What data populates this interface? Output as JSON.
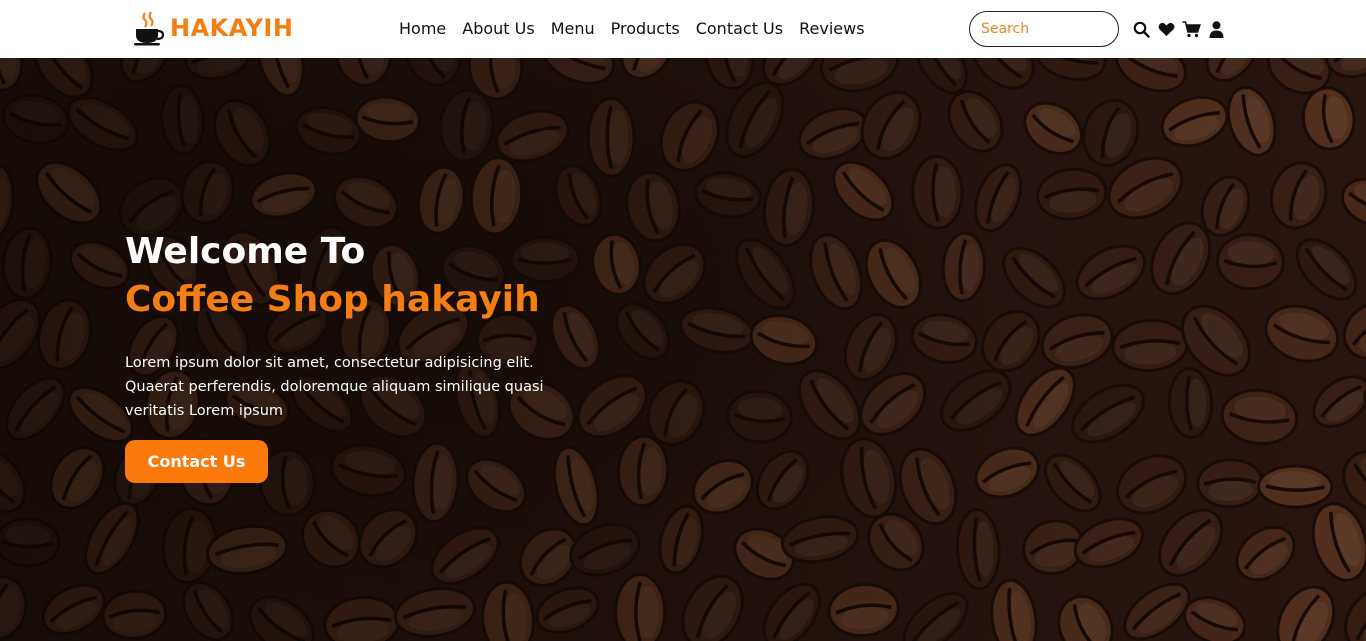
{
  "brand": {
    "name": "HAKAYIH",
    "logo_icon": "coffee-cup-icon"
  },
  "nav": {
    "links": [
      {
        "label": "Home"
      },
      {
        "label": "About Us"
      },
      {
        "label": "Menu"
      },
      {
        "label": "Products"
      },
      {
        "label": "Contact Us"
      },
      {
        "label": "Reviews"
      }
    ]
  },
  "search": {
    "placeholder": "Search",
    "value": ""
  },
  "icons": [
    "search-icon",
    "heart-icon",
    "cart-icon",
    "user-icon"
  ],
  "hero": {
    "title": "Welcome To",
    "subtitle": "Coffee Shop hakayih",
    "text": "Lorem ipsum dolor sit amet, consectetur adipisicing elit. Quaerat perferendis, doloremque aliquam similique quasi veritatis Lorem ipsum",
    "button_label": "Contact Us",
    "background": "coffee-beans-image"
  },
  "colors": {
    "accent": "#f37e14",
    "button": "#fb7a0b",
    "hero_bg": "#2a1610"
  }
}
